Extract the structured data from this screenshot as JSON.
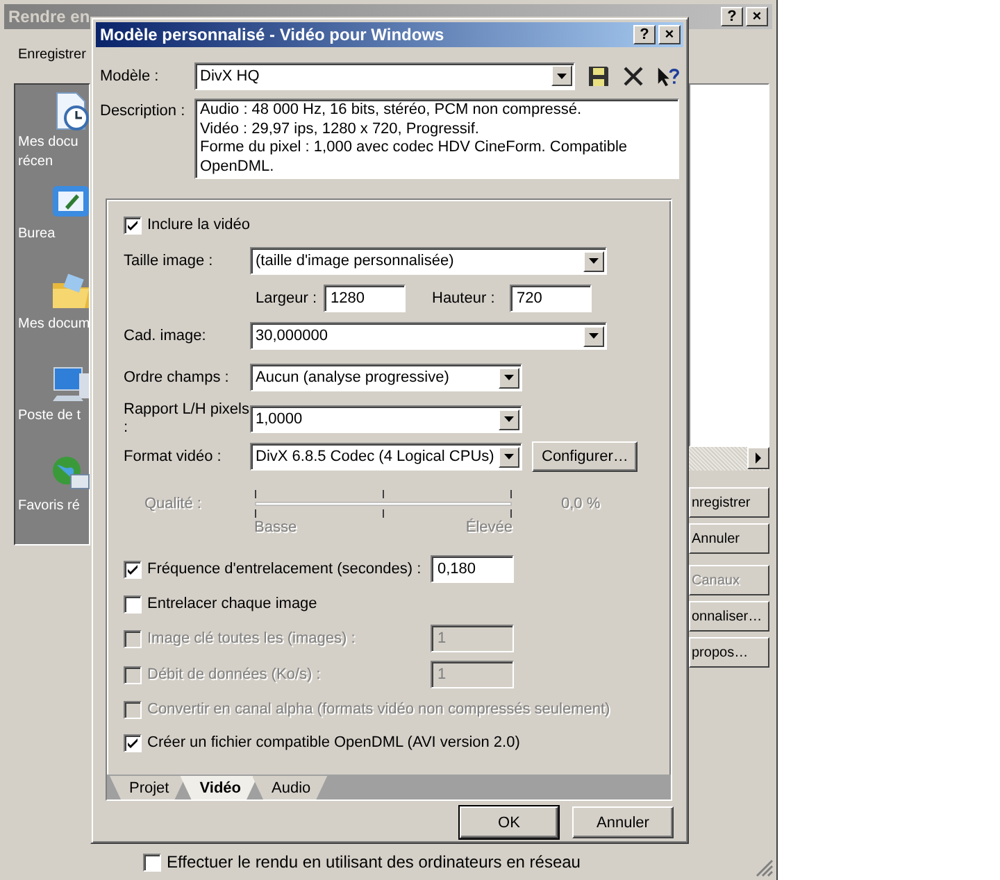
{
  "background_window": {
    "title": "Rendre en",
    "title_buttons": [
      "?",
      "×"
    ],
    "save_label": "Enregistrer",
    "places": [
      {
        "lines": [
          "Mes docu",
          "récen"
        ]
      },
      {
        "lines": [
          "Burea"
        ]
      },
      {
        "lines": [
          "Mes docum"
        ]
      },
      {
        "lines": [
          "Poste de t"
        ]
      },
      {
        "lines": [
          "Favoris ré"
        ]
      }
    ],
    "buttons": [
      {
        "label": "nregistrer",
        "disabled": false
      },
      {
        "label": "Annuler",
        "disabled": false
      },
      {
        "label": "Canaux",
        "disabled": true
      },
      {
        "label": "onnaliser…",
        "disabled": false
      },
      {
        "label": "propos…",
        "disabled": false
      }
    ],
    "network_render": {
      "label": "Effectuer le rendu en utilisant des ordinateurs en réseau",
      "checked": false
    }
  },
  "dialog": {
    "title": "Modèle personnalisé - Vidéo pour Windows",
    "title_buttons": [
      "?",
      "×"
    ],
    "preset": {
      "label": "Modèle :",
      "value": "DivX HQ"
    },
    "description": {
      "label": "Description :",
      "lines": [
        "Audio : 48 000 Hz, 16 bits, stéréo, PCM non compressé.",
        "Vidéo : 29,97 ips, 1280 x 720, Progressif.",
        "Forme du pixel : 1,000 avec codec HDV CineForm. Compatible",
        "OpenDML."
      ]
    },
    "video_settings": [
      {
        "kind": "checkbox",
        "label": "Inclure la vidéo",
        "checked": true,
        "disabled": false
      },
      {
        "kind": "combo",
        "label": "Taille image :",
        "value": "(taille d'image personnalisée)"
      },
      {
        "kind": "size",
        "width_label": "Largeur :",
        "width_value": "1280",
        "height_label": "Hauteur :",
        "height_value": "720"
      },
      {
        "kind": "combo",
        "label": "Cad. image:",
        "value": "30,000000"
      },
      {
        "kind": "combo_short",
        "label": "Ordre champs :",
        "value": "Aucun (analyse progressive)"
      },
      {
        "kind": "combo_short",
        "label": "Rapport L/H pixels :",
        "value": "1,0000"
      },
      {
        "kind": "combo_button",
        "label": "Format vidéo :",
        "value": "DivX 6.8.5 Codec (4 Logical CPUs)",
        "button": "Configurer…"
      },
      {
        "kind": "slider",
        "label": "Qualité :",
        "low_label": "Basse",
        "high_label": "Élevée",
        "reading": "0,0 %",
        "disabled": true
      },
      {
        "kind": "checkbox_field",
        "label": "Fréquence d'entrelacement (secondes) :",
        "checked": true,
        "disabled": false,
        "value": "0,180"
      },
      {
        "kind": "checkbox",
        "label": "Entrelacer chaque image",
        "checked": false,
        "disabled": false
      },
      {
        "kind": "checkbox_field",
        "label": "Image clé toutes les (images) :",
        "checked": false,
        "disabled": true,
        "value": "1"
      },
      {
        "kind": "checkbox_field",
        "label": "Débit de données (Ko/s) :",
        "checked": false,
        "disabled": true,
        "value": "1"
      },
      {
        "kind": "checkbox",
        "label": "Convertir en canal alpha (formats vidéo non compressés seulement)",
        "checked": false,
        "disabled": true
      },
      {
        "kind": "checkbox",
        "label": "Créer un fichier compatible OpenDML (AVI version 2.0)",
        "checked": true,
        "disabled": false
      }
    ],
    "tabs": [
      {
        "label": "Projet",
        "selected": false
      },
      {
        "label": "Vidéo",
        "selected": true
      },
      {
        "label": "Audio",
        "selected": false
      }
    ],
    "buttons": [
      "OK",
      "Annuler"
    ]
  }
}
